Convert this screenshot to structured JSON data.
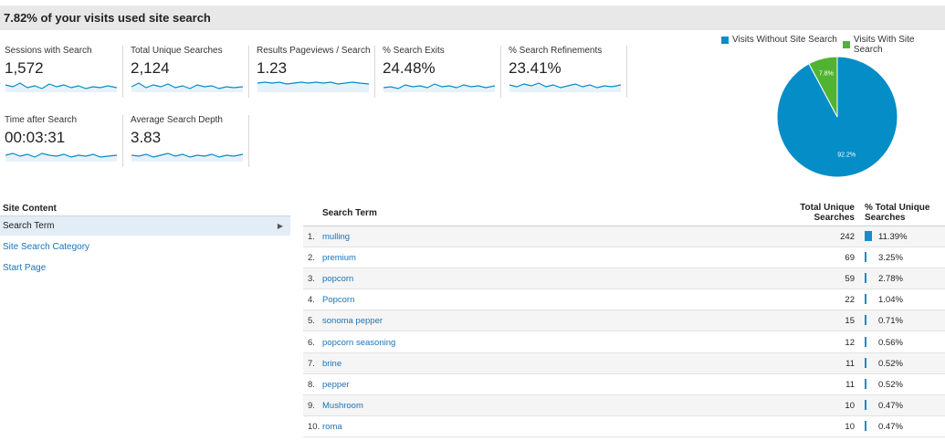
{
  "header": {
    "title": "7.82% of your visits used site search"
  },
  "metrics": [
    {
      "label": "Sessions with Search",
      "value": "1,572"
    },
    {
      "label": "Total Unique Searches",
      "value": "2,124"
    },
    {
      "label": "Results Pageviews / Search",
      "value": "1.23"
    },
    {
      "label": "% Search Exits",
      "value": "24.48%"
    },
    {
      "label": "% Search Refinements",
      "value": "23.41%"
    },
    {
      "label": "Time after Search",
      "value": "00:03:31"
    },
    {
      "label": "Average Search Depth",
      "value": "3.83"
    }
  ],
  "pie": {
    "legend": [
      {
        "label": "Visits Without Site Search",
        "color": "#058dc7"
      },
      {
        "label": "Visits With Site Search",
        "color": "#50b432"
      }
    ],
    "slices": [
      {
        "name": "Visits Without Site Search",
        "value": 92.2,
        "label": "92.2%",
        "color": "#058dc7"
      },
      {
        "name": "Visits With Site Search",
        "value": 7.8,
        "label": "7.8%",
        "color": "#50b432"
      }
    ]
  },
  "sidebar": {
    "heading": "Site Content",
    "items": [
      {
        "label": "Search Term",
        "active": true
      },
      {
        "label": "Site Search Category",
        "active": false
      },
      {
        "label": "Start Page",
        "active": false
      }
    ]
  },
  "table": {
    "col_term": "Search Term",
    "col_tus_1": "Total Unique",
    "col_tus_2": "Searches",
    "col_pct_1": "% Total Unique",
    "col_pct_2": "Searches",
    "rows": [
      {
        "num": "1.",
        "term": "mulling",
        "count": "242",
        "pct": "11.39%",
        "pct_value": 11.39
      },
      {
        "num": "2.",
        "term": "premium",
        "count": "69",
        "pct": "3.25%",
        "pct_value": 3.25
      },
      {
        "num": "3.",
        "term": "popcorn",
        "count": "59",
        "pct": "2.78%",
        "pct_value": 2.78
      },
      {
        "num": "4.",
        "term": "Popcorn",
        "count": "22",
        "pct": "1.04%",
        "pct_value": 1.04
      },
      {
        "num": "5.",
        "term": "sonoma pepper",
        "count": "15",
        "pct": "0.71%",
        "pct_value": 0.71
      },
      {
        "num": "6.",
        "term": "popcorn seasoning",
        "count": "12",
        "pct": "0.56%",
        "pct_value": 0.56
      },
      {
        "num": "7.",
        "term": "brine",
        "count": "11",
        "pct": "0.52%",
        "pct_value": 0.52
      },
      {
        "num": "8.",
        "term": "pepper",
        "count": "11",
        "pct": "0.52%",
        "pct_value": 0.52
      },
      {
        "num": "9.",
        "term": "Mushroom",
        "count": "10",
        "pct": "0.47%",
        "pct_value": 0.47
      },
      {
        "num": "10.",
        "term": "roma",
        "count": "10",
        "pct": "0.47%",
        "pct_value": 0.47
      }
    ]
  }
}
